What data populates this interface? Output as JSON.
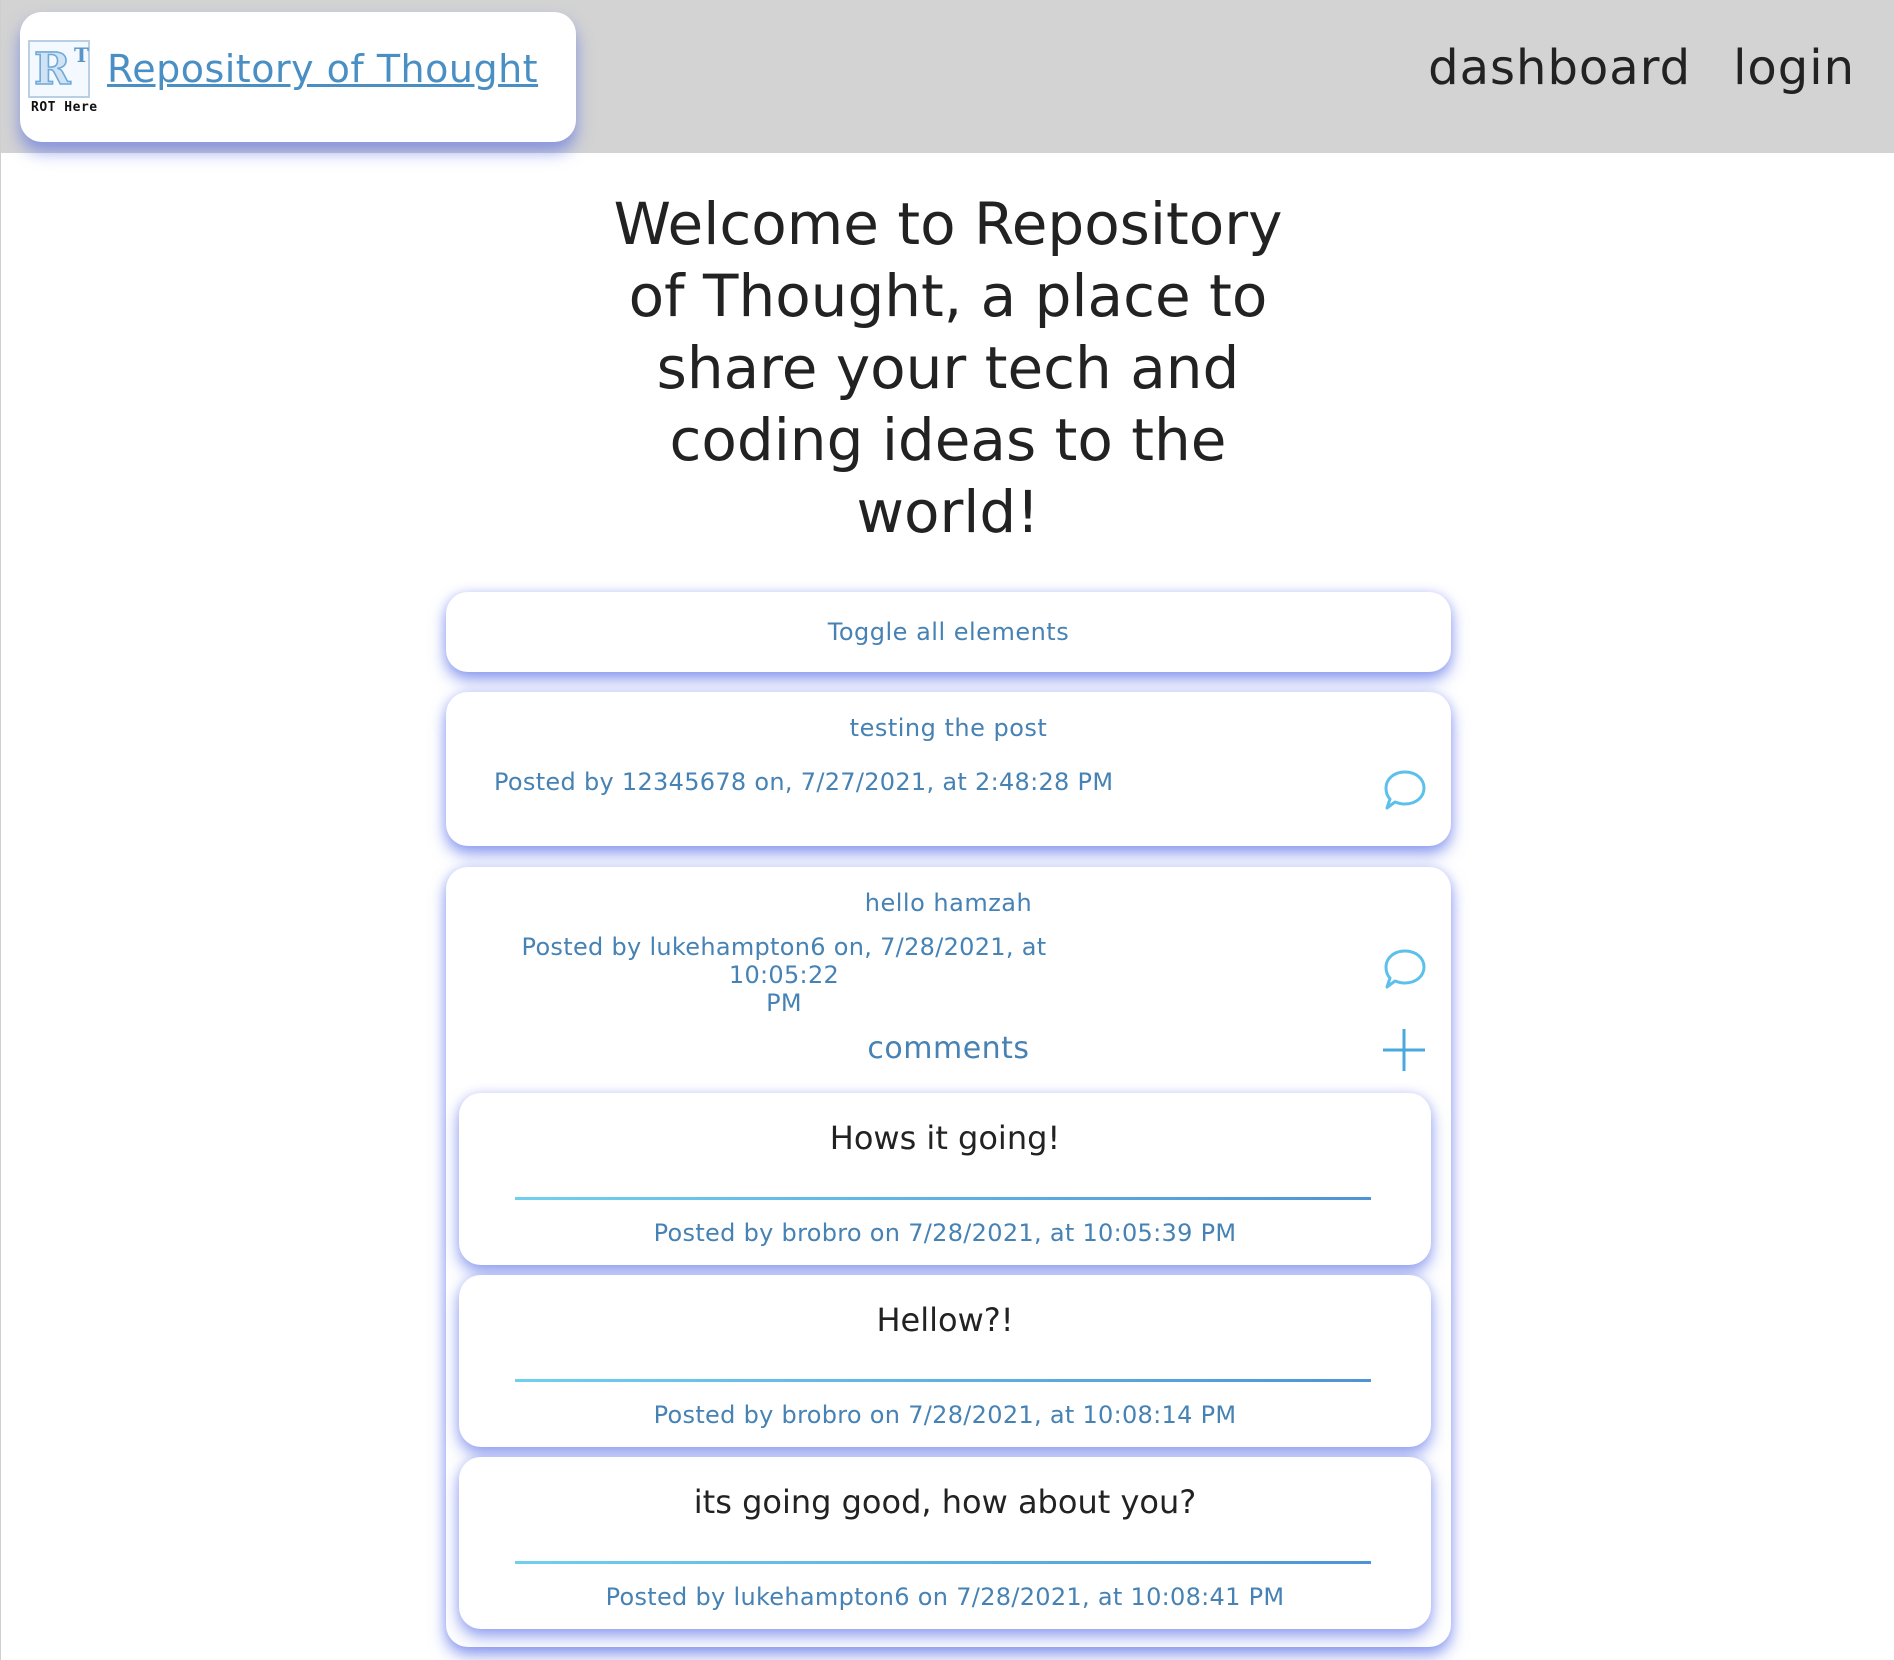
{
  "header": {
    "brand_title": "Repository of Thought",
    "logo_caption": "ROT Here",
    "logo_letter_main": "R",
    "logo_letter_sup": "T",
    "nav": [
      {
        "label": "dashboard"
      },
      {
        "label": "login"
      }
    ]
  },
  "hero": {
    "heading": "Welcome to Repository of Thought, a place to share your tech and coding ideas to the world!"
  },
  "toggle": {
    "label": "Toggle all elements"
  },
  "posts": [
    {
      "title": "testing the post",
      "meta": "Posted by 12345678 on, 7/27/2021, at 2:48:28 PM",
      "icon": "chat-bubble-icon"
    },
    {
      "title": "hello hamzah",
      "meta_line1": "Posted by lukehampton6 on, 7/28/2021, at 10:05:22",
      "meta_line2": "PM",
      "icon": "chat-bubble-icon",
      "comments_heading": "comments",
      "add_icon": "plus-icon",
      "comments": [
        {
          "text": "Hows it going!",
          "meta": "Posted by brobro on 7/28/2021, at 10:05:39 PM"
        },
        {
          "text": "Hellow?!",
          "meta": "Posted by brobro on 7/28/2021, at 10:08:14 PM"
        },
        {
          "text": "its going good, how about you?",
          "meta": "Posted by lukehampton6 on 7/28/2021, at 10:08:41 PM"
        }
      ]
    }
  ],
  "colors": {
    "header_bg": "#d3d3d3",
    "link_blue": "#4a8fc4",
    "text_blue": "#4682b4",
    "shadow_blue": "#465fe6",
    "icon_blue": "#5bc0eb"
  }
}
